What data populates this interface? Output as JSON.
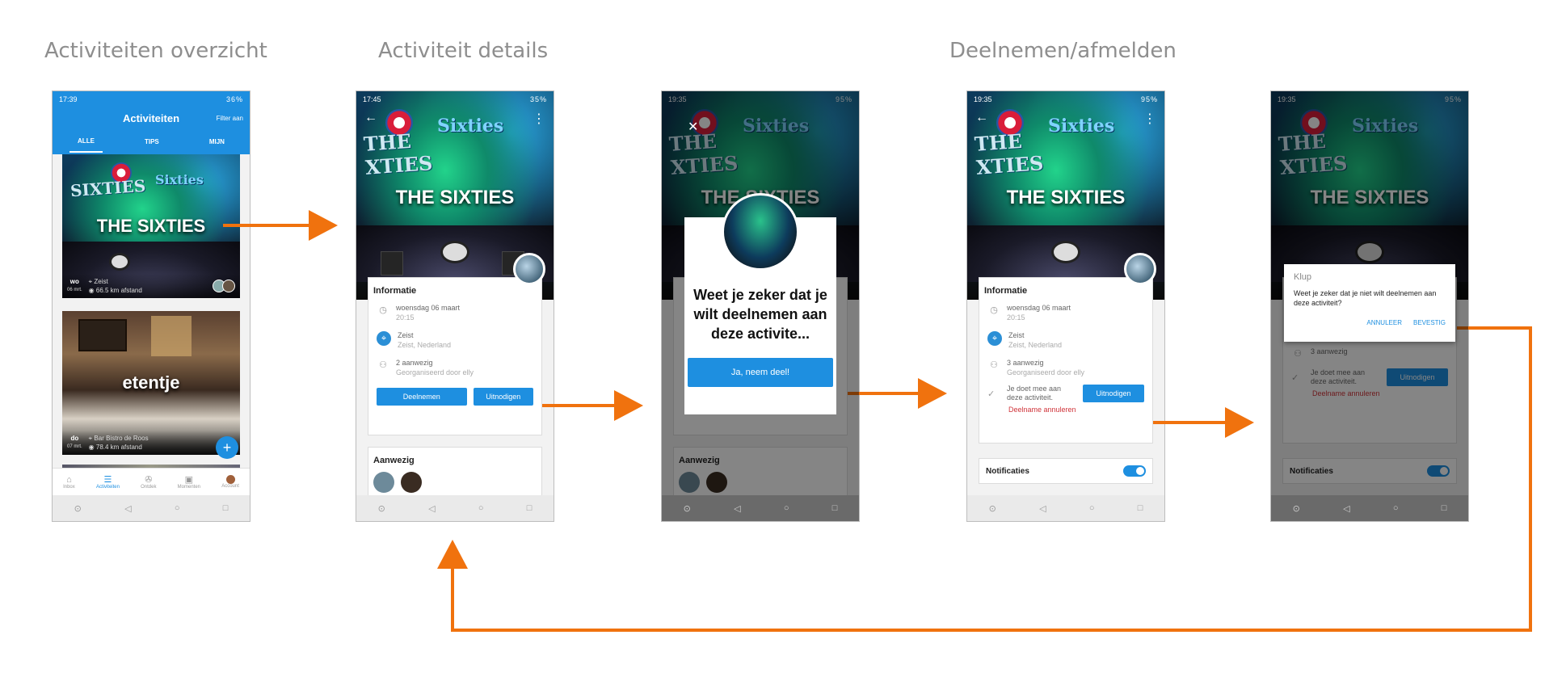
{
  "headings": {
    "overview": "Activiteiten overzicht",
    "details": "Activiteit details",
    "join": "Deelnemen/afmelden"
  },
  "accent": "#1e8fe0",
  "arrow_color": "#f0720e",
  "screen1": {
    "status_time": "17:39",
    "status_right": "36%",
    "appbar_title": "Activiteiten",
    "appbar_action": "Filter aan",
    "tabs": [
      "ALLE",
      "TIPS",
      "MIJN"
    ],
    "cards": [
      {
        "title": "THE SIXTIES",
        "day": "wo",
        "date": "06 mrt.",
        "place": "Zeist",
        "distance": "66.5 km afstand"
      },
      {
        "title": "etentje",
        "day": "do",
        "date": "07 mrt.",
        "place": "Bar Bistro de Roos",
        "distance": "78.4 km afstand"
      }
    ],
    "fab": "+",
    "bottom_nav": [
      "Inbox",
      "Activiteiten",
      "Ontdek",
      "Momenten",
      "Account"
    ]
  },
  "screen2": {
    "status_time": "17:45",
    "status_right": "35%",
    "hero_title": "THE SIXTIES",
    "info_title": "Informatie",
    "date": "woensdag 06 maart",
    "time": "20:15",
    "place": "Zeist",
    "place_sub": "Zeist, Nederland",
    "attendees": "2 aanwezig",
    "organizer": "Georganiseerd door elly",
    "join_button": "Deelnemen",
    "second_button": "Uitnodigen",
    "present_title": "Aanwezig"
  },
  "screen3": {
    "status_time": "19:35",
    "status_right": "95%",
    "dialog_question": "Weet je zeker dat je wilt deelnemen aan deze activite...",
    "confirm_button": "Ja, neem deel!",
    "present_title": "Aanwezig"
  },
  "screen4": {
    "status_time": "19:35",
    "status_right": "95%",
    "info_title": "Informatie",
    "date": "woensdag 06 maart",
    "time": "20:15",
    "place": "Zeist",
    "place_sub": "Zeist, Nederland",
    "attendees": "3 aanwezig",
    "organizer": "Georganiseerd door elly",
    "joined_text": "Je doet mee aan deze activiteit.",
    "invite_button": "Uitnodigen",
    "cancel_link": "Deelname annuleren",
    "notifications": "Notificaties"
  },
  "screen5": {
    "status_time": "19:35",
    "status_right": "95%",
    "dialog_app": "Klup",
    "dialog_text": "Weet je zeker dat je niet wilt deelnemen aan deze activiteit?",
    "cancel": "ANNULEER",
    "confirm": "BEVESTIG",
    "attendees": "3 aanwezig",
    "joined_text": "Je doet mee aan deze activiteit.",
    "invite_button": "Uitnodigen",
    "cancel_link": "Deelname annuleren",
    "notifications": "Notificaties"
  }
}
